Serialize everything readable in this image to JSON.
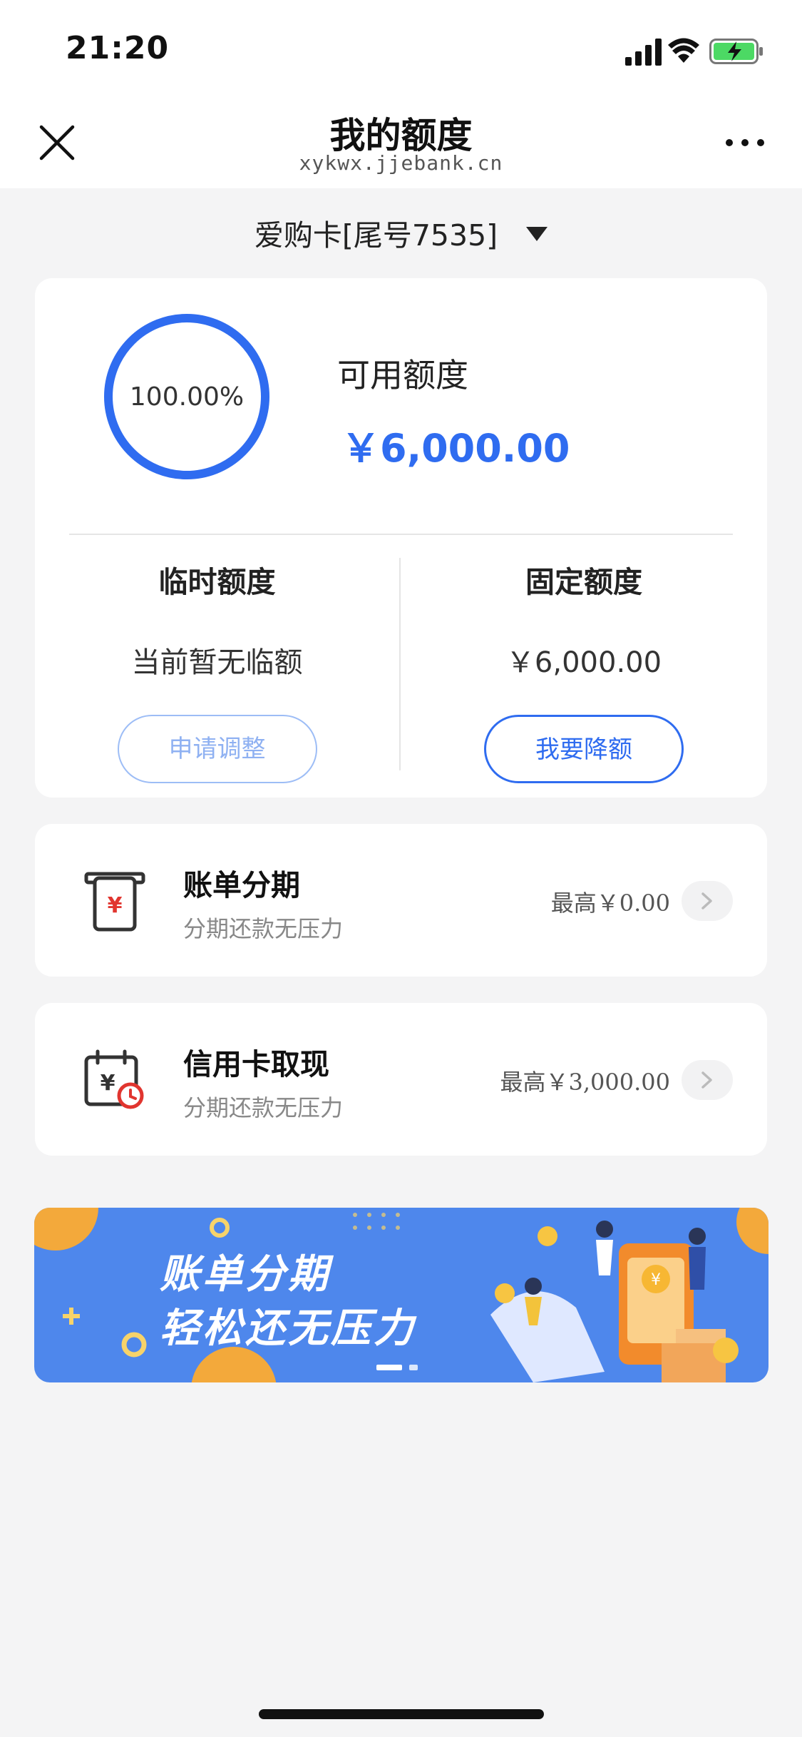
{
  "status_bar": {
    "time": "21:20",
    "icons": [
      "signal-icon",
      "wifi-icon",
      "battery-charging-icon"
    ]
  },
  "nav": {
    "title": "我的额度",
    "subtitle": "xykwx.jjebank.cn",
    "close_icon": "close-icon",
    "more_icon": "more-icon"
  },
  "card_selector": {
    "label": "爱购卡[尾号7535]",
    "icon": "dropdown-triangle-icon"
  },
  "credit": {
    "percent_text": "100.00%",
    "percent_value": 1.0,
    "available_label": "可用额度",
    "available_value": "￥6,000.00",
    "temporary": {
      "title": "临时额度",
      "value": "当前暂无临额",
      "button": "申请调整"
    },
    "fixed": {
      "title": "固定额度",
      "value": "￥6,000.00",
      "button": "我要降额"
    }
  },
  "services": [
    {
      "icon": "bill-installment-icon",
      "title": "账单分期",
      "subtitle": "分期还款无压力",
      "amount": "最高￥0.00"
    },
    {
      "icon": "cash-withdrawal-icon",
      "title": "信用卡取现",
      "subtitle": "分期还款无压力",
      "amount": "最高￥3,000.00"
    }
  ],
  "banner": {
    "line1": "账单分期",
    "line2": "轻松还无压力",
    "pager": {
      "count": 2,
      "active": 1
    }
  },
  "colors": {
    "accent": "#2f6cf0",
    "banner_bg": "#4e87ec",
    "page_bg": "#f4f4f5",
    "icon_red": "#e1352f",
    "battery_green": "#4cd964"
  }
}
